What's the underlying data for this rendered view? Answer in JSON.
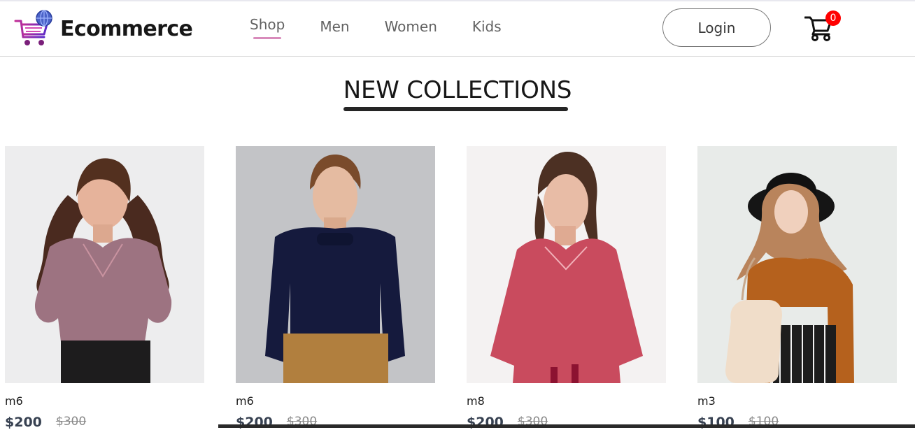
{
  "app": {
    "brand": "Ecommerce",
    "logo_icon": "shopping-cart-globe-icon"
  },
  "nav": {
    "items": [
      {
        "label": "Shop",
        "active": true
      },
      {
        "label": "Men",
        "active": false
      },
      {
        "label": "Women",
        "active": false
      },
      {
        "label": "Kids",
        "active": false
      }
    ],
    "login_label": "Login",
    "cart_count": "0",
    "cart_icon": "cart-icon"
  },
  "section": {
    "title": "NEW COLLECTIONS"
  },
  "products": [
    {
      "name": "m6",
      "new_price": "$200",
      "old_price": "$300"
    },
    {
      "name": "m6",
      "new_price": "$200",
      "old_price": "$300"
    },
    {
      "name": "m8",
      "new_price": "$200",
      "old_price": "$300"
    },
    {
      "name": "m3",
      "new_price": "$100",
      "old_price": "$100"
    }
  ],
  "colors": {
    "accent": "#d88bbb",
    "badge": "#ff0000",
    "text": "#171717",
    "price": "#374151",
    "old_price": "#8a8a8a"
  }
}
